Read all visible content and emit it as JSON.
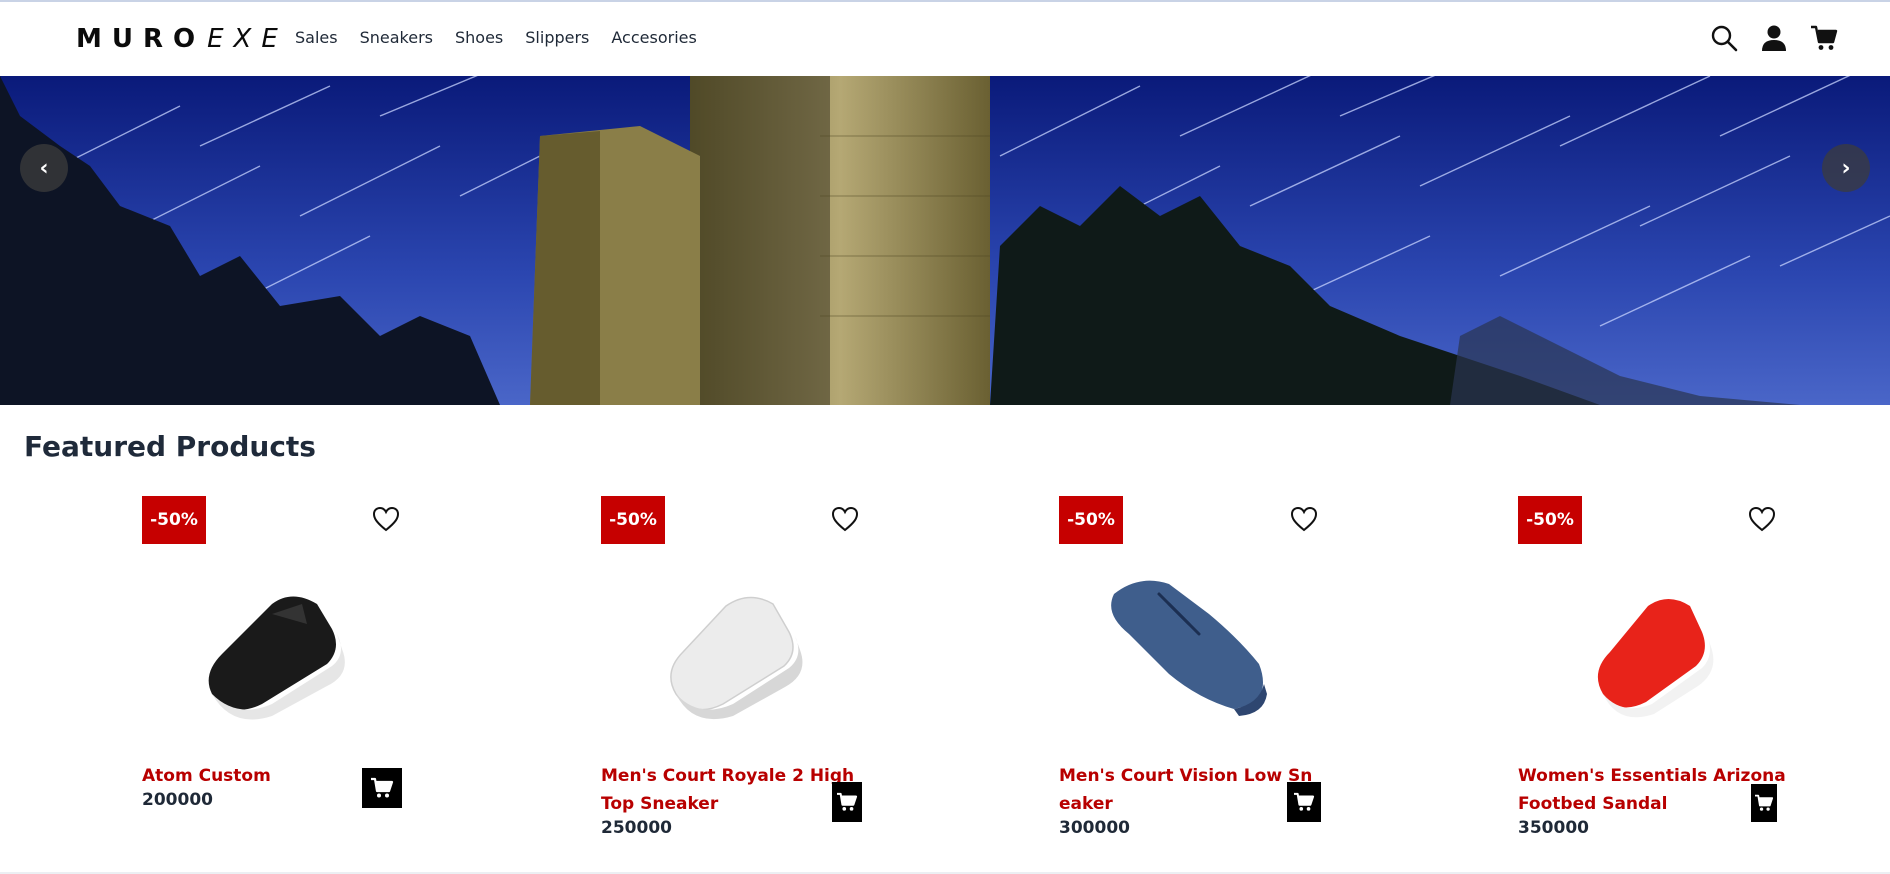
{
  "brand": {
    "bold": "MURO",
    "italic": "EXE"
  },
  "nav": [
    "Sales",
    "Sneakers",
    "Shoes",
    "Slippers",
    "Accesories"
  ],
  "header_icons": [
    "search-icon",
    "user-icon",
    "cart-icon"
  ],
  "hero": {
    "prev": "‹",
    "next": "›"
  },
  "featured": {
    "title": "Featured Products",
    "products": [
      {
        "badge": "-50%",
        "name_lines": [
          "Atom Custom"
        ],
        "price": "200000",
        "shoe_color": "#1a1a1a"
      },
      {
        "badge": "-50%",
        "name_lines": [
          "Men's Court Royale 2 High",
          "Top Sneaker"
        ],
        "price": "250000",
        "shoe_color": "#e9e9e9"
      },
      {
        "badge": "-50%",
        "name_lines": [
          "Men's Court Vision Low Sn",
          "eaker"
        ],
        "price": "300000",
        "shoe_color": "#3f5e8c"
      },
      {
        "badge": "-50%",
        "name_lines": [
          "Women's Essentials Arizona",
          "Footbed Sandal"
        ],
        "price": "350000",
        "shoe_color": "#e8231a"
      }
    ]
  },
  "colors": {
    "accent": "#c60000",
    "price": "#1f2937",
    "hero_sky": "#0b1f6e"
  }
}
